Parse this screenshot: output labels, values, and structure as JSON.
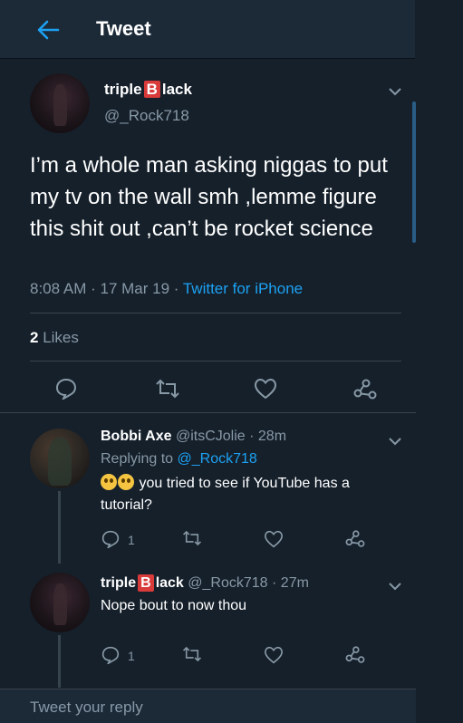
{
  "header": {
    "title": "Tweet",
    "back_icon": "back-arrow-icon"
  },
  "tweet": {
    "name_part1": "triple",
    "name_badge": "B",
    "name_part2": "lack",
    "handle": "@_Rock718",
    "text": "I’m a whole man asking niggas to put my tv on the wall smh ,lemme figure this shit out ,can’t be rocket science",
    "time": "8:08 AM",
    "sep1": " · ",
    "date": "17 Mar 19",
    "sep2": " · ",
    "source": "Twitter for iPhone",
    "likes_count": "2",
    "likes_label": "Likes"
  },
  "replies": [
    {
      "name": "Bobbi Axe",
      "handle": "@itsCJolie",
      "age": " · 28m",
      "replying_prefix": "Replying to",
      "replying_to": "@_Rock718",
      "text": "you tried to see if YouTube has a tutorial?",
      "reply_count": "1"
    },
    {
      "name_part1": "triple",
      "name_badge": "B",
      "name_part2": "lack",
      "handle": "@_Rock718",
      "age": " · 27m",
      "text": "Nope bout to now thou",
      "reply_count": "1"
    }
  ],
  "composer": {
    "placeholder": "Tweet your reply"
  },
  "colors": {
    "background": "#15202b",
    "accent": "#1da1f2",
    "muted": "#8899a6",
    "badge": "#d93a3a"
  }
}
